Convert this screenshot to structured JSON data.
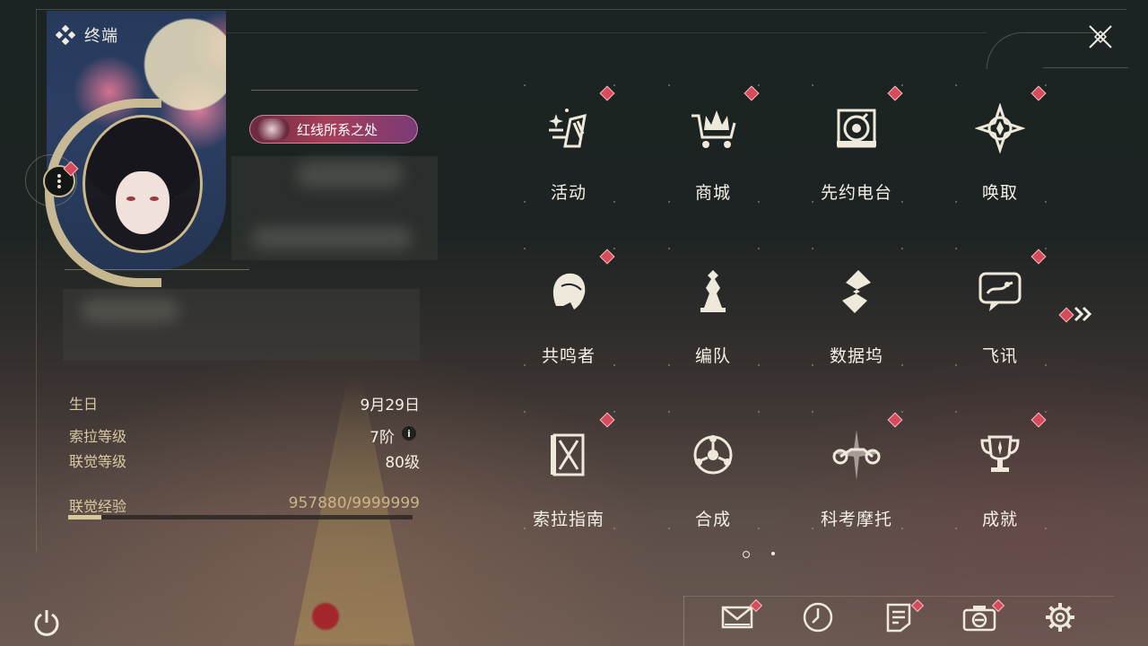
{
  "header": {
    "title": "终端"
  },
  "profile": {
    "nameplate_label": "红线所系之处",
    "stats": {
      "birthday_label": "生日",
      "birthday_value": "9月29日",
      "sola_level_label": "索拉等级",
      "sola_level_value": "7阶",
      "union_level_label": "联觉等级",
      "union_level_value": "80级",
      "union_exp_label": "联觉经验",
      "union_exp_value": "957880/9999999",
      "union_exp_progress": 0.0958
    }
  },
  "menu": {
    "tiles": [
      {
        "label": "活动",
        "icon": "activity-icon",
        "badge": true
      },
      {
        "label": "商城",
        "icon": "shop-crown-cart-icon",
        "badge": true
      },
      {
        "label": "先约电台",
        "icon": "radio-icon",
        "badge": true
      },
      {
        "label": "唤取",
        "icon": "convene-compass-icon",
        "badge": true
      },
      {
        "label": "共鸣者",
        "icon": "resonator-portrait-icon",
        "badge": true
      },
      {
        "label": "编队",
        "icon": "team-chess-icon",
        "badge": false
      },
      {
        "label": "数据坞",
        "icon": "data-bank-icon",
        "badge": false
      },
      {
        "label": "飞讯",
        "icon": "message-bubble-icon",
        "badge": true
      },
      {
        "label": "索拉指南",
        "icon": "guidebook-icon",
        "badge": true
      },
      {
        "label": "合成",
        "icon": "synthesis-icon",
        "badge": false
      },
      {
        "label": "科考摩托",
        "icon": "motorbike-icon",
        "badge": true
      },
      {
        "label": "成就",
        "icon": "trophy-icon",
        "badge": true
      }
    ],
    "page_index": 1,
    "page_count": 2
  },
  "bottom_bar": {
    "items": [
      {
        "name": "mail",
        "icon": "mail-icon",
        "badge": true
      },
      {
        "name": "clock",
        "icon": "clock-icon",
        "badge": false
      },
      {
        "name": "notes",
        "icon": "notes-icon",
        "badge": true
      },
      {
        "name": "camera",
        "icon": "camera-icon",
        "badge": true
      },
      {
        "name": "settings",
        "icon": "gear-icon",
        "badge": false
      }
    ]
  },
  "colors": {
    "accent_gold": "#d8c79b",
    "badge_red": "#d64a5a",
    "text_light": "#f4f0e6"
  }
}
